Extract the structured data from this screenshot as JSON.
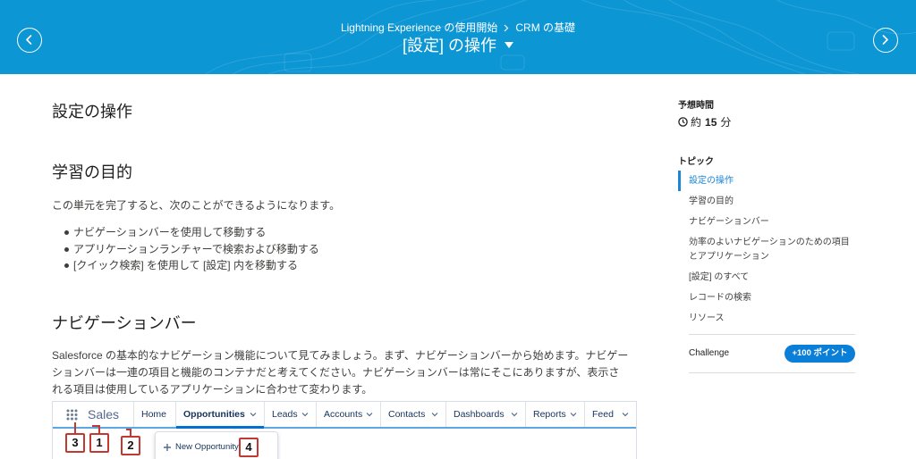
{
  "header": {
    "prev_icon": "chevron-left-icon",
    "next_icon": "chevron-right-icon",
    "breadcrumb": [
      {
        "label": "Lightning Experience の使用開始"
      },
      {
        "label": "CRM の基礎"
      }
    ],
    "breadcrumb_separator_icon": "chevron-right-icon",
    "title": "[設定] の操作",
    "title_icon": "caret-down-icon"
  },
  "content": {
    "unit_title": "設定の操作",
    "objectives_heading": "学習の目的",
    "objectives_intro": "この単元を完了すると、次のことができるようになります。",
    "objectives": [
      "ナビゲーションバーを使用して移動する",
      "アプリケーションランチャーで検索および移動する",
      "[クイック検索] を使用して [設定] 内を移動する"
    ],
    "section_heading": "ナビゲーションバー",
    "section_paragraph": "Salesforce の基本的なナビゲーション機能について見てみましょう。まず、ナビゲーションバーから始めます。ナビゲーションバーは一連の項目と機能のコンテナだと考えてください。ナビゲーションバーは常にそこにありますが、表示される項目は使用しているアプリケーションに合わせて変わります。",
    "figure": {
      "app_launcher_icon": "app-launcher-grid-icon",
      "app_name": "Sales",
      "menu_icon": "chevron-down-icon",
      "nav_items": [
        {
          "label": "Home",
          "menu": false,
          "active": false
        },
        {
          "label": "Opportunities",
          "menu": true,
          "active": true
        },
        {
          "label": "Leads",
          "menu": true,
          "active": false
        },
        {
          "label": "Accounts",
          "menu": true,
          "active": false
        },
        {
          "label": "Contacts",
          "menu": true,
          "active": false
        },
        {
          "label": "Dashboards",
          "menu": true,
          "active": false
        },
        {
          "label": "Reports",
          "menu": true,
          "active": false
        },
        {
          "label": "Feed",
          "menu": true,
          "active": false
        }
      ],
      "dropdown_item": {
        "icon": "plus-icon",
        "label": "New Opportunity"
      },
      "callouts": [
        "3",
        "1",
        "2",
        "4"
      ]
    }
  },
  "sidebar": {
    "time_label": "予想時間",
    "time_icon": "clock-icon",
    "time_prefix": "約",
    "time_value": "15",
    "time_unit": "分",
    "topics_label": "トピック",
    "topics": [
      {
        "label": "設定の操作",
        "active": true
      },
      {
        "label": "学習の目的",
        "active": false
      },
      {
        "label": "ナビゲーションバー",
        "active": false
      },
      {
        "label": "効率のよいナビゲーションのための項目とアプリケーション",
        "active": false
      },
      {
        "label": "[設定] のすべて",
        "active": false
      },
      {
        "label": "レコードの検索",
        "active": false
      },
      {
        "label": "リソース",
        "active": false
      }
    ],
    "challenge_label": "Challenge",
    "challenge_points": "+100 ポイント"
  },
  "colors": {
    "header_background": "#0d96d4",
    "accent": "#1b86d6",
    "badge": "#0b7fd8",
    "callout_border": "#c23934",
    "figure_nav_active": "#0070d2"
  }
}
